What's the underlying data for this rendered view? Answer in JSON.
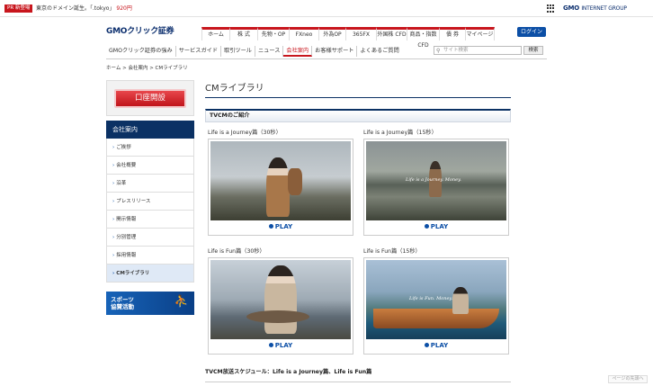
{
  "topbar": {
    "pr_badge": "PR 新登場",
    "pr_text": "東京のドメイン誕生。「.tokyo」",
    "pr_price": "920円",
    "group_logo": "GMO",
    "group_logo_suffix": "INTERNET GROUP",
    "grid_icon": "apps-grid-icon"
  },
  "header": {
    "logo_gmo": "GMO",
    "logo_rest": "クリック証券",
    "main_nav": [
      {
        "label": "ホーム",
        "width": 32
      },
      {
        "label": "株 式",
        "width": 31
      },
      {
        "label": "先物・OP",
        "width": 35
      },
      {
        "label": "FXneo",
        "width": 33
      },
      {
        "label": "外為OP",
        "width": 30
      },
      {
        "label": "365FX",
        "width": 34
      },
      {
        "label": "外国株 CFD",
        "width": 34
      },
      {
        "label": "商品・指数 CFD",
        "width": 36
      },
      {
        "label": "債 券",
        "width": 29
      },
      {
        "label": "マイページ",
        "width": 32
      }
    ],
    "login_label": "ログイン",
    "sub_nav": [
      {
        "label": "GMOクリック証券の強み",
        "active": false
      },
      {
        "label": "サービスガイド",
        "active": false
      },
      {
        "label": "取引ツール",
        "active": false
      },
      {
        "label": "ニュース",
        "active": false
      },
      {
        "label": "会社案内",
        "active": true
      },
      {
        "label": "お客様サポート",
        "active": false
      },
      {
        "label": "よくあるご質問",
        "active": false
      }
    ],
    "search_placeholder": "サイト検索",
    "search_button": "検索"
  },
  "breadcrumb": "ホーム > 会社案内 > CMライブラリ",
  "sidebar": {
    "open_account_label": "口座開設",
    "section_title": "会社案内",
    "items": [
      {
        "label": "ご挨拶",
        "current": false
      },
      {
        "label": "会社概要",
        "current": false
      },
      {
        "label": "沿革",
        "current": false
      },
      {
        "label": "プレスリリース",
        "current": false
      },
      {
        "label": "開示情報",
        "current": false
      },
      {
        "label": "分別管理",
        "current": false
      },
      {
        "label": "採用情報",
        "current": false
      },
      {
        "label": "CMライブラリ",
        "current": true
      }
    ],
    "sports_banner_line1": "スポーツ",
    "sports_banner_line2": "協賛活動"
  },
  "content": {
    "page_title": "CMライブラリ",
    "section_title": "TVCMのご紹介",
    "play_label": "PLAY",
    "videos": [
      {
        "title": "Life is a Journey篇（30秒）",
        "caption": ""
      },
      {
        "title": "Life is a Journey篇（15秒）",
        "caption": "Life is a Journey.  Money."
      },
      {
        "title": "Life is Fun篇（30秒）",
        "caption": ""
      },
      {
        "title": "Life is Fun篇（15秒）",
        "caption": "Life is Fun.  Money."
      }
    ],
    "schedule_title": "TVCM放送スケジュール：Life is a Journey篇、Life is Fun篇"
  },
  "page_top_label": "ページの先頭へ"
}
